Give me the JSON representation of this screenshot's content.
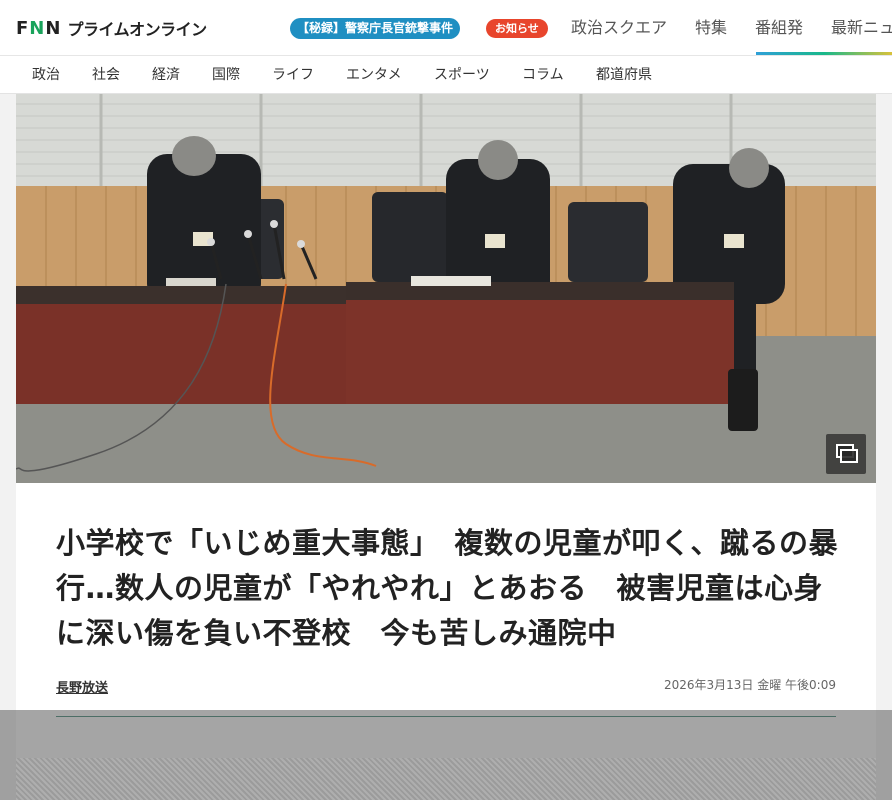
{
  "header": {
    "logo_fnn": "FNN",
    "logo_sub": "プライムオンライン",
    "topic_pill": "【秘録】警察庁長官銃撃事件",
    "notice_pill": "お知らせ",
    "nav": [
      "政治スクエア",
      "特集",
      "番組発",
      "最新ニュ"
    ]
  },
  "categories": [
    "政治",
    "社会",
    "経済",
    "国際",
    "ライフ",
    "エンタメ",
    "スポーツ",
    "コラム",
    "都道府県"
  ],
  "article": {
    "headline": "小学校で「いじめ重大事態」　複数の児童が叩く、蹴るの暴行…数人の児童が「やれやれ」とあおる　被害児童は心身に深い傷を負い不登校　今も苦しみ通院中",
    "source": "長野放送",
    "date": "2026年3月13日 金曜 午後0:09"
  },
  "icons": {
    "gallery": "gallery-icon"
  },
  "colors": {
    "topic_pill": "#1f8fc2",
    "notice_pill": "#e8452c",
    "logo_green": "#19a35b",
    "rule": "#1a6e5a"
  }
}
